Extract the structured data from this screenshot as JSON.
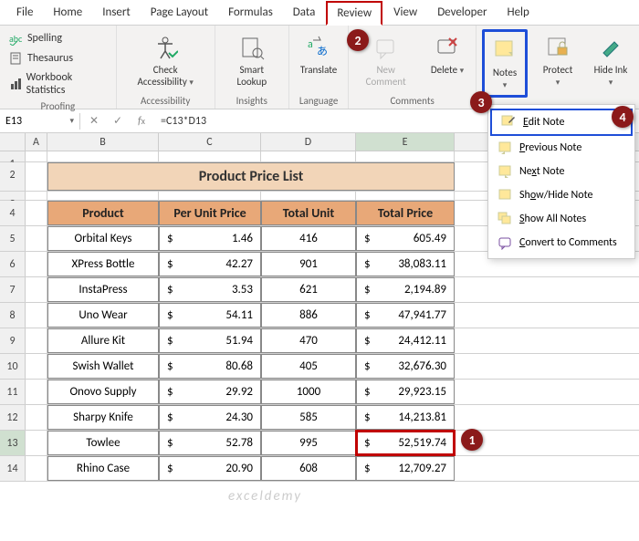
{
  "tabs": [
    "File",
    "Home",
    "Insert",
    "Page Layout",
    "Formulas",
    "Data",
    "Review",
    "View",
    "Developer",
    "Help"
  ],
  "active_tab": "Review",
  "ribbon": {
    "proofing": {
      "label": "Proofing",
      "spelling": "Spelling",
      "thesaurus": "Thesaurus",
      "stats": "Workbook Statistics"
    },
    "accessibility": {
      "label": "Accessibility",
      "btn": "Check Accessibility"
    },
    "insights": {
      "label": "Insights",
      "btn": "Smart Lookup"
    },
    "language": {
      "label": "Language",
      "btn": "Translate"
    },
    "comments": {
      "label": "Comments",
      "new": "New Comment",
      "delete": "Delete"
    },
    "notes": {
      "btn": "Notes"
    },
    "protect": {
      "btn": "Protect"
    },
    "ink": {
      "btn": "Hide Ink"
    }
  },
  "name_box": "E13",
  "formula": "=C13*D13",
  "columns": [
    "A",
    "B",
    "C",
    "D",
    "E"
  ],
  "table_title": "Product Price List",
  "headers": [
    "Product",
    "Per Unit Price",
    "Total Unit",
    "Total Price"
  ],
  "rows": [
    {
      "n": 5,
      "product": "Orbital Keys",
      "unit_price": "1.46",
      "units": "416",
      "total": "605.49"
    },
    {
      "n": 6,
      "product": "XPress Bottle",
      "unit_price": "42.27",
      "units": "901",
      "total": "38,083.11"
    },
    {
      "n": 7,
      "product": "InstaPress",
      "unit_price": "3.53",
      "units": "621",
      "total": "2,194.89"
    },
    {
      "n": 8,
      "product": "Uno Wear",
      "unit_price": "54.11",
      "units": "886",
      "total": "47,941.77"
    },
    {
      "n": 9,
      "product": "Allure Kit",
      "unit_price": "51.94",
      "units": "470",
      "total": "24,412.11"
    },
    {
      "n": 10,
      "product": "Swish Wallet",
      "unit_price": "80.68",
      "units": "405",
      "total": "32,676.30"
    },
    {
      "n": 11,
      "product": "Onovo Supply",
      "unit_price": "29.92",
      "units": "1000",
      "total": "29,923.15"
    },
    {
      "n": 12,
      "product": "Sharpy Knife",
      "unit_price": "24.30",
      "units": "585",
      "total": "14,213.81"
    },
    {
      "n": 13,
      "product": "Towlee",
      "unit_price": "52.78",
      "units": "995",
      "total": "52,519.74"
    },
    {
      "n": 14,
      "product": "Rhino Case",
      "unit_price": "20.90",
      "units": "608",
      "total": "12,709.27"
    }
  ],
  "selected_row": 13,
  "currency": "$",
  "dropdown": {
    "edit": "Edit Note",
    "previous": "Previous Note",
    "next": "Next Note",
    "showhide": "Show/Hide Note",
    "showall": "Show All Notes",
    "convert": "Convert to Comments"
  },
  "callouts": {
    "1": "1",
    "2": "2",
    "3": "3",
    "4": "4"
  },
  "watermark": "exceldemy"
}
